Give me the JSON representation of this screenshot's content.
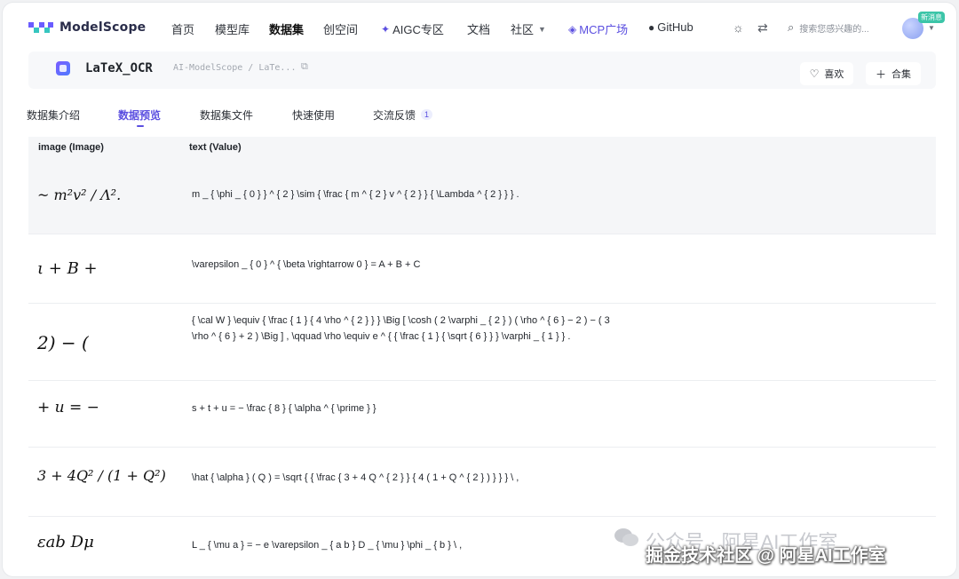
{
  "nav": {
    "logo_text": "ModelScope",
    "items": [
      "首页",
      "模型库",
      "数据集",
      "创空间",
      "AIGC专区",
      "文档",
      "社区",
      "MCP广场",
      "GitHub"
    ],
    "search_placeholder": "搜索您感兴趣的...",
    "new_badge": "新消息",
    "colors": {
      "accent": "#5b4fe0",
      "badge": "#3cc5a8"
    }
  },
  "dataset": {
    "title": "LaTeX_OCR",
    "path": "AI-ModelScope / LaTe...",
    "like_label": "喜欢",
    "collect_label": "合集"
  },
  "tabs": {
    "items": [
      "数据集介绍",
      "数据预览",
      "数据集文件",
      "快速使用",
      "交流反馈"
    ],
    "active": "数据预览",
    "feedback_count": "1"
  },
  "table": {
    "headers": [
      "image (Image)",
      "text (Value)"
    ],
    "rows": [
      {
        "image": "~ m²v² / Λ².",
        "text": "m _ { \\phi _ { 0 } } ^ { 2 } \\sim { \\frac { m ^ { 2 } v ^ { 2 } } { \\Lambda ^ { 2 } } } ."
      },
      {
        "image": "ι + B +",
        "text": "\\varepsilon _ { 0 } ^ { \\beta \\rightarrow 0 } = A + B + C"
      },
      {
        "image": "2) − (",
        "text": "{ \\cal W } \\equiv { \\frac { 1 } { 4 \\rho ^ { 2 } } } \\Big [ \\cosh ( 2 \\varphi _ { 2 } ) ( \\rho ^ { 6 } − 2 ) − ( 3 \\rho ^ { 6 } + 2 ) \\Big ] , \\qquad \\rho \\equiv e ^ { { \\frac { 1 } { \\sqrt { 6 } } } \\varphi _ { 1 } } ."
      },
      {
        "image": "+ u = −",
        "text": "s + t + u = − \\frac { 8 } { \\alpha ^ { \\prime } }"
      },
      {
        "image": "3 + 4Q² / (1 + Q²)",
        "text": "\\hat { \\alpha } ( Q ) = \\sqrt { { \\frac { 3 + 4 Q ^ { 2 } } { 4 ( 1 + Q ^ { 2 } ) } } } \\ ,"
      },
      {
        "image": "εab Dμ",
        "text": "L _ { \\mu a } = − e \\varepsilon _ { a b } D _ { \\mu } \\phi _ { b } \\ ,"
      }
    ]
  },
  "watermark": {
    "line1": "公众号 · 阿星AI工作室",
    "line2": "掘金技术社区 @ 阿星AI工作室"
  }
}
